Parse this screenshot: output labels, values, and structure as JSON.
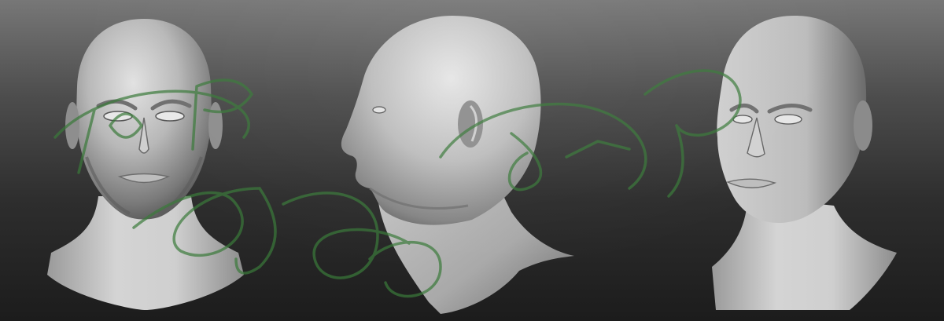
{
  "scene": {
    "views": [
      "front",
      "profile",
      "three-quarter"
    ],
    "background_top": "#777777",
    "background_bottom": "#1c1c1c",
    "model_color": "#b4b4b4"
  },
  "watermark": {
    "text": "ZBrush Sculpt",
    "color": "#3a7a3a"
  }
}
